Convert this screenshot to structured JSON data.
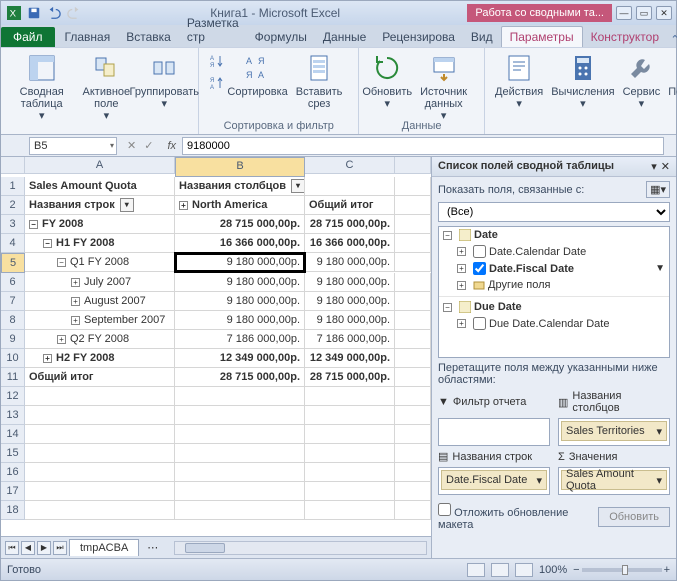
{
  "title": "Книга1 - Microsoft Excel",
  "contextTab": "Работа со сводными та...",
  "tabs": {
    "file": "Файл",
    "home": "Главная",
    "insert": "Вставка",
    "layout": "Разметка стр",
    "formulas": "Формулы",
    "data": "Данные",
    "review": "Рецензирова",
    "view": "Вид",
    "options": "Параметры",
    "design": "Конструктор"
  },
  "ribbon": {
    "pivot": "Сводная таблица",
    "active": "Активное поле",
    "group": "Группировать",
    "sort": "Сортировка",
    "slicer": "Вставить срез",
    "refresh": "Обновить",
    "source": "Источник данных",
    "actions": "Действия",
    "calc": "Вычисления",
    "tools": "Сервис",
    "show": "Показать",
    "gSortFilter": "Сортировка и фильтр",
    "gData": "Данные"
  },
  "namebox": "B5",
  "formula": "9180000",
  "cols": [
    "A",
    "B",
    "C"
  ],
  "hdr": {
    "a1": "Sales Amount Quota",
    "b1": "Названия столбцов",
    "a2": "Названия строк",
    "b2": "North America",
    "c2": "Общий итог"
  },
  "rows": [
    {
      "n": 3,
      "a": "FY 2008",
      "b": "28 715 000,00p.",
      "c": "28 715 000,00p.",
      "bold": true,
      "exp": "−",
      "ind": 0
    },
    {
      "n": 4,
      "a": "H1 FY 2008",
      "b": "16 366 000,00p.",
      "c": "16 366 000,00p.",
      "bold": true,
      "exp": "−",
      "ind": 1
    },
    {
      "n": 5,
      "a": "Q1 FY 2008",
      "b": "9 180 000,00p.",
      "c": "9 180 000,00p.",
      "bold": false,
      "exp": "−",
      "ind": 2,
      "active": true
    },
    {
      "n": 6,
      "a": "July 2007",
      "b": "9 180 000,00p.",
      "c": "9 180 000,00p.",
      "bold": false,
      "exp": "+",
      "ind": 3
    },
    {
      "n": 7,
      "a": "August 2007",
      "b": "9 180 000,00p.",
      "c": "9 180 000,00p.",
      "bold": false,
      "exp": "+",
      "ind": 3
    },
    {
      "n": 8,
      "a": "September 2007",
      "b": "9 180 000,00p.",
      "c": "9 180 000,00p.",
      "bold": false,
      "exp": "+",
      "ind": 3
    },
    {
      "n": 9,
      "a": "Q2 FY 2008",
      "b": "7 186 000,00p.",
      "c": "7 186 000,00p.",
      "bold": false,
      "exp": "+",
      "ind": 2
    },
    {
      "n": 10,
      "a": "H2 FY 2008",
      "b": "12 349 000,00p.",
      "c": "12 349 000,00p.",
      "bold": true,
      "exp": "+",
      "ind": 1
    },
    {
      "n": 11,
      "a": "Общий итог",
      "b": "28 715 000,00p.",
      "c": "28 715 000,00p.",
      "bold": true,
      "exp": "",
      "ind": 0
    }
  ],
  "sheetTab": "tmpACBA",
  "status": "Готово",
  "zoom": "100%",
  "pane": {
    "title": "Список полей сводной таблицы",
    "showLbl": "Показать поля, связанные с:",
    "showSel": "(Все)",
    "tree": {
      "date": "Date",
      "cal": "Date.Calendar Date",
      "fiscal": "Date.Fiscal Date",
      "other": "Другие поля",
      "due": "Due Date",
      "dueCal": "Due Date.Calendar Date"
    },
    "dragLbl": "Перетащите поля между указанными ниже областями:",
    "areaFilter": "Фильтр отчета",
    "areaCols": "Названия столбцов",
    "areaRows": "Названия строк",
    "areaVals": "Значения",
    "itemCols": "Sales Territories",
    "itemRows": "Date.Fiscal Date",
    "itemVals": "Sales Amount Quota",
    "defer": "Отложить обновление макета",
    "update": "Обновить"
  }
}
